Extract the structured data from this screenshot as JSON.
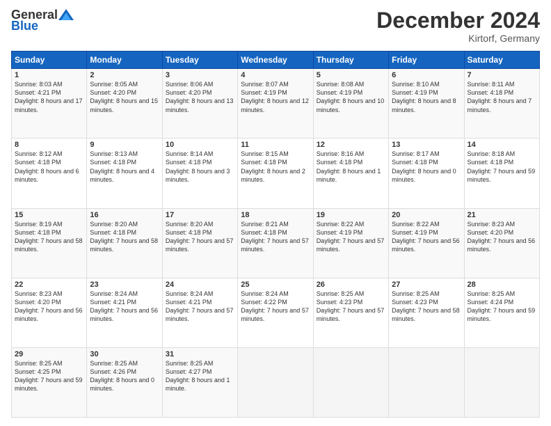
{
  "logo": {
    "general": "General",
    "blue": "Blue"
  },
  "header": {
    "month": "December 2024",
    "location": "Kirtorf, Germany"
  },
  "days": [
    "Sunday",
    "Monday",
    "Tuesday",
    "Wednesday",
    "Thursday",
    "Friday",
    "Saturday"
  ],
  "weeks": [
    [
      {
        "day": "1",
        "info": "Sunrise: 8:03 AM\nSunset: 4:21 PM\nDaylight: 8 hours and 17 minutes."
      },
      {
        "day": "2",
        "info": "Sunrise: 8:05 AM\nSunset: 4:20 PM\nDaylight: 8 hours and 15 minutes."
      },
      {
        "day": "3",
        "info": "Sunrise: 8:06 AM\nSunset: 4:20 PM\nDaylight: 8 hours and 13 minutes."
      },
      {
        "day": "4",
        "info": "Sunrise: 8:07 AM\nSunset: 4:19 PM\nDaylight: 8 hours and 12 minutes."
      },
      {
        "day": "5",
        "info": "Sunrise: 8:08 AM\nSunset: 4:19 PM\nDaylight: 8 hours and 10 minutes."
      },
      {
        "day": "6",
        "info": "Sunrise: 8:10 AM\nSunset: 4:19 PM\nDaylight: 8 hours and 8 minutes."
      },
      {
        "day": "7",
        "info": "Sunrise: 8:11 AM\nSunset: 4:18 PM\nDaylight: 8 hours and 7 minutes."
      }
    ],
    [
      {
        "day": "8",
        "info": "Sunrise: 8:12 AM\nSunset: 4:18 PM\nDaylight: 8 hours and 6 minutes."
      },
      {
        "day": "9",
        "info": "Sunrise: 8:13 AM\nSunset: 4:18 PM\nDaylight: 8 hours and 4 minutes."
      },
      {
        "day": "10",
        "info": "Sunrise: 8:14 AM\nSunset: 4:18 PM\nDaylight: 8 hours and 3 minutes."
      },
      {
        "day": "11",
        "info": "Sunrise: 8:15 AM\nSunset: 4:18 PM\nDaylight: 8 hours and 2 minutes."
      },
      {
        "day": "12",
        "info": "Sunrise: 8:16 AM\nSunset: 4:18 PM\nDaylight: 8 hours and 1 minute."
      },
      {
        "day": "13",
        "info": "Sunrise: 8:17 AM\nSunset: 4:18 PM\nDaylight: 8 hours and 0 minutes."
      },
      {
        "day": "14",
        "info": "Sunrise: 8:18 AM\nSunset: 4:18 PM\nDaylight: 7 hours and 59 minutes."
      }
    ],
    [
      {
        "day": "15",
        "info": "Sunrise: 8:19 AM\nSunset: 4:18 PM\nDaylight: 7 hours and 58 minutes."
      },
      {
        "day": "16",
        "info": "Sunrise: 8:20 AM\nSunset: 4:18 PM\nDaylight: 7 hours and 58 minutes."
      },
      {
        "day": "17",
        "info": "Sunrise: 8:20 AM\nSunset: 4:18 PM\nDaylight: 7 hours and 57 minutes."
      },
      {
        "day": "18",
        "info": "Sunrise: 8:21 AM\nSunset: 4:18 PM\nDaylight: 7 hours and 57 minutes."
      },
      {
        "day": "19",
        "info": "Sunrise: 8:22 AM\nSunset: 4:19 PM\nDaylight: 7 hours and 57 minutes."
      },
      {
        "day": "20",
        "info": "Sunrise: 8:22 AM\nSunset: 4:19 PM\nDaylight: 7 hours and 56 minutes."
      },
      {
        "day": "21",
        "info": "Sunrise: 8:23 AM\nSunset: 4:20 PM\nDaylight: 7 hours and 56 minutes."
      }
    ],
    [
      {
        "day": "22",
        "info": "Sunrise: 8:23 AM\nSunset: 4:20 PM\nDaylight: 7 hours and 56 minutes."
      },
      {
        "day": "23",
        "info": "Sunrise: 8:24 AM\nSunset: 4:21 PM\nDaylight: 7 hours and 56 minutes."
      },
      {
        "day": "24",
        "info": "Sunrise: 8:24 AM\nSunset: 4:21 PM\nDaylight: 7 hours and 57 minutes."
      },
      {
        "day": "25",
        "info": "Sunrise: 8:24 AM\nSunset: 4:22 PM\nDaylight: 7 hours and 57 minutes."
      },
      {
        "day": "26",
        "info": "Sunrise: 8:25 AM\nSunset: 4:23 PM\nDaylight: 7 hours and 57 minutes."
      },
      {
        "day": "27",
        "info": "Sunrise: 8:25 AM\nSunset: 4:23 PM\nDaylight: 7 hours and 58 minutes."
      },
      {
        "day": "28",
        "info": "Sunrise: 8:25 AM\nSunset: 4:24 PM\nDaylight: 7 hours and 59 minutes."
      }
    ],
    [
      {
        "day": "29",
        "info": "Sunrise: 8:25 AM\nSunset: 4:25 PM\nDaylight: 7 hours and 59 minutes."
      },
      {
        "day": "30",
        "info": "Sunrise: 8:25 AM\nSunset: 4:26 PM\nDaylight: 8 hours and 0 minutes."
      },
      {
        "day": "31",
        "info": "Sunrise: 8:25 AM\nSunset: 4:27 PM\nDaylight: 8 hours and 1 minute."
      },
      null,
      null,
      null,
      null
    ]
  ]
}
